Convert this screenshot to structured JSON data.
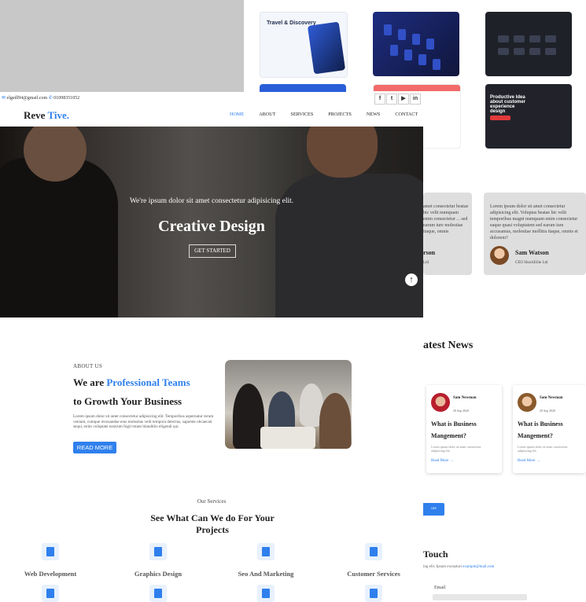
{
  "topbar": {
    "email": "elgedl94@gmail.com",
    "phone": "01098351052",
    "socials": [
      "f",
      "twitter",
      "youtube",
      "linkedin"
    ]
  },
  "brand": {
    "part1": "Reve",
    "part2": "Tive."
  },
  "nav": {
    "items": [
      "HOME",
      "ABOUT",
      "SERVICES",
      "PROJECTS",
      "NEWS",
      "CONTACT"
    ],
    "active": "HOME"
  },
  "hero": {
    "subtitle": "We're ipsum dolor sit amet consectetur adipisicing elit.",
    "title": "Creative Design",
    "button": "GET STARTED"
  },
  "about": {
    "label": "ABOUT US",
    "heading_prefix": "We are",
    "heading_highlight": "Professional Teams",
    "heading_line2": "to Growth Your Business",
    "paragraph": "Lorem ipsum dolor sit amet consectetur adipisicing elit. Temporibus aspernatur rerum veniam, cumque recusandae eius molestias velit tempora delectus, sapiente obcaecati sequi, enim voluptate nostrum fugit totam blanditiis eligendi qui.",
    "button": "READ MORE"
  },
  "services": {
    "label": "Our Services",
    "title": "See What Can We do For Your Projects",
    "items": [
      "Web Development",
      "Graphics Design",
      "Seo And Marketing",
      "Customer Services"
    ]
  },
  "projects_preview": {
    "card1_title": "Travel & Discovery",
    "card6_title": "Productive Idea about customer experience design"
  },
  "testimonials": {
    "text": "Lorem ipsum dolor sit amet consectetur adipisicing elit. Voluptas beatae hic velit temporibus magni numquam enim consectetur eaque quasi voluptatem sed earum iure accusamus, molestiae mollitia itaque, omnis et dolorem?",
    "partial_text": "amet consectetur beatae hic velit numquam enim consectetur ... sed earum iure molestiae itaque, omnis",
    "partial_name": "rson",
    "partial_role": "Ltd",
    "name": "Sam Watson",
    "role": "CEO ShockElite Ltd"
  },
  "news": {
    "heading": "atest News",
    "cards": [
      {
        "author": "Sam Newman",
        "date": "20 Sep 2020",
        "title": "What is Business Mangement?",
        "text": "Lorem ipsum dolor sit amet consectetur adipisicing elit.",
        "link": "Read More →"
      },
      {
        "author": "Sam Newman",
        "date": "20 Sep 2020",
        "title": "What is Business Mangement?",
        "text": "Lorem ipsum dolor sit amet consectetur adipisicing elit.",
        "link": "Read More →"
      }
    ],
    "button": "ore"
  },
  "contact": {
    "heading": "Touch",
    "text": "ing elit. Ipsum excepturi",
    "email_link": "example@mail.com",
    "email_label": "Email"
  },
  "colors": {
    "accent": "#2f80ed"
  }
}
